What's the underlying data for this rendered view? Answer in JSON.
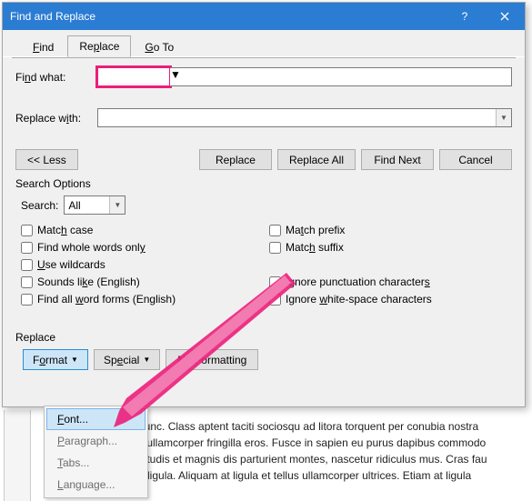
{
  "dialog": {
    "title": "Find and Replace",
    "tabs": {
      "find": "Find",
      "replace": "Replace",
      "goto": "Go To"
    },
    "find_label_pre": "Fi",
    "find_label_u": "n",
    "find_label_post": "d what:",
    "replace_label_pre": "Replace w",
    "replace_label_u": "i",
    "replace_label_post": "th:",
    "find_value": "",
    "replace_value": "",
    "less_btn": "<< Less",
    "replace_btn": "Replace",
    "replace_all_btn": "Replace All",
    "find_next_btn": "Find Next",
    "cancel_btn": "Cancel",
    "search_options_label": "Search Options",
    "search_dir_label": "Search:",
    "search_dir_value": "All",
    "cb": {
      "match_case": "Match case",
      "whole_words": "Find whole words only",
      "wildcards": "Use wildcards",
      "sounds_like": "Sounds like (English)",
      "word_forms": "Find all word forms (English)",
      "match_prefix": "Match prefix",
      "match_suffix": "Match suffix",
      "ignore_punct": "Ignore punctuation characters",
      "ignore_ws": "Ignore white-space characters"
    },
    "replace_section": "Replace",
    "format_btn": "Format",
    "special_btn": "Special",
    "no_formatting_btn": "No Formatting",
    "menu": {
      "font": "Font...",
      "paragraph": "Paragraph...",
      "tabs": "Tabs...",
      "language": "Language..."
    }
  },
  "bg": {
    "p1": "nunc. Class aptent taciti sociosqu ad litora torquent per conubia nostra",
    "p2": "c ullamcorper fringilla eros. Fusce in sapien eu purus dapibus commodo",
    "p3": "bitudis et magnis dis parturient montes, nascetur ridiculus mus. Cras fau",
    "p4": "h ligula. Aliquam at ligula et tellus ullamcorper ultrices. Etiam at ligula"
  }
}
